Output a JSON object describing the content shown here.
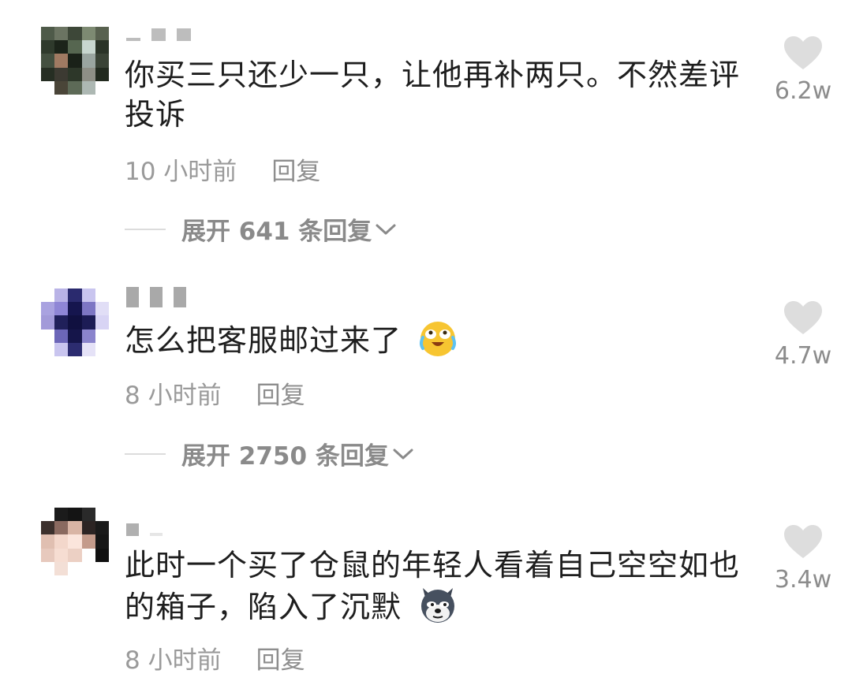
{
  "comments": [
    {
      "text_line1": "你买三只还少一只，让他再补两只。不然差评",
      "text_line2": "投诉",
      "time": "10 小时前",
      "reply_label": "回复",
      "expand_label": "展开 641 条回复",
      "likes": "6.2w"
    },
    {
      "text_line1": "怎么把客服邮过来了",
      "emoji": "crying-laughing-emoji",
      "time": "8 小时前",
      "reply_label": "回复",
      "expand_label": "展开 2750 条回复",
      "likes": "4.7w"
    },
    {
      "text_line1": "此时一个买了仓鼠的年轻人看着自己空空如也",
      "text_line2": "的箱子，陷入了沉默",
      "emoji": "husky-dog-emoji",
      "time": "8 小时前",
      "reply_label": "回复",
      "likes": "3.4w"
    }
  ],
  "icons": {
    "heart": "heart-icon",
    "chevron": "chevron-down-icon"
  },
  "colors": {
    "meta_gray": "#9a9a9a",
    "heart_gray": "#dddddd",
    "text": "#1e1e1e"
  }
}
